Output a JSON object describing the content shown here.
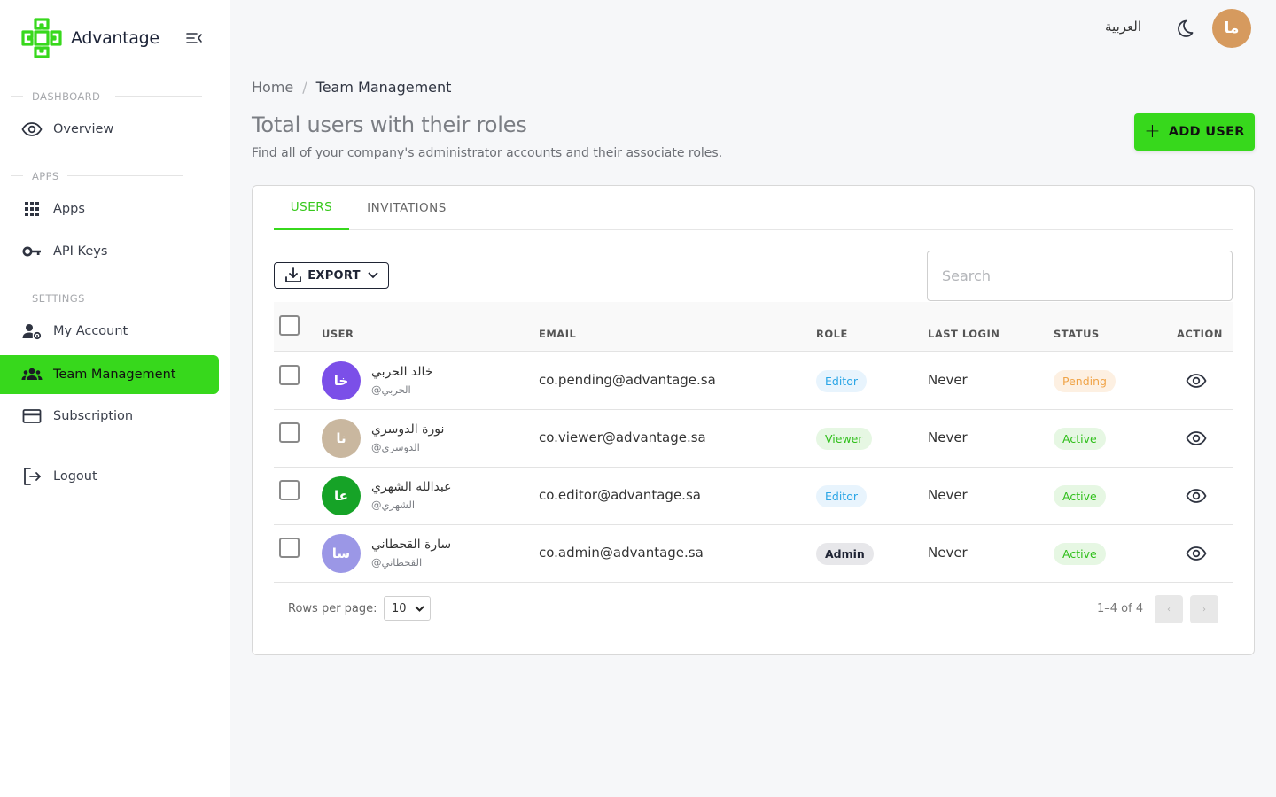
{
  "app": {
    "brand_name": "Advantage",
    "brand_color": "#37d81c"
  },
  "topbar": {
    "language_link": "العربية",
    "avatar_initials": "ما",
    "avatar_color": "#d69a5e"
  },
  "sidebar": {
    "sections": [
      {
        "label": "DASHBOARD",
        "items": [
          {
            "label": "Overview",
            "icon": "eye-icon"
          }
        ]
      },
      {
        "label": "APPS",
        "items": [
          {
            "label": "Apps",
            "icon": "apps-grid-icon"
          },
          {
            "label": "API Keys",
            "icon": "key-icon"
          }
        ]
      },
      {
        "label": "SETTINGS",
        "items": [
          {
            "label": "My Account",
            "icon": "user-settings-icon"
          },
          {
            "label": "Team Management",
            "icon": "team-icon",
            "active": true
          },
          {
            "label": "Subscription",
            "icon": "credit-card-icon"
          }
        ]
      }
    ],
    "logout_label": "Logout"
  },
  "breadcrumb": {
    "home": "Home",
    "separator": "/",
    "current": "Team Management"
  },
  "header": {
    "title": "Total users with their roles",
    "subtitle": "Find all of your company's administrator accounts and their associate roles.",
    "add_user_label": "ADD USER"
  },
  "tabs": [
    {
      "label": "USERS",
      "active": true
    },
    {
      "label": "INVITATIONS",
      "active": false
    }
  ],
  "toolbar": {
    "export_label": "EXPORT",
    "search_placeholder": "Search"
  },
  "table": {
    "columns": [
      "USER",
      "EMAIL",
      "ROLE",
      "LAST LOGIN",
      "STATUS",
      "ACTION"
    ],
    "rows": [
      {
        "initials": "خا",
        "avatar_color": "#7b4fe8",
        "name": "خالد الحربي",
        "handle": "@الحربي",
        "email": "co.pending@advantage.sa",
        "role": "Editor",
        "role_style": "editor",
        "last_login": "Never",
        "status": "Pending",
        "status_style": "pending"
      },
      {
        "initials": "نا",
        "avatar_color": "#c9b79f",
        "name": "نورة الدوسري",
        "handle": "@الدوسري",
        "email": "co.viewer@advantage.sa",
        "role": "Viewer",
        "role_style": "viewer",
        "last_login": "Never",
        "status": "Active",
        "status_style": "active"
      },
      {
        "initials": "عا",
        "avatar_color": "#16a327",
        "name": "عبدالله الشهري",
        "handle": "@الشهري",
        "email": "co.editor@advantage.sa",
        "role": "Editor",
        "role_style": "editor",
        "last_login": "Never",
        "status": "Active",
        "status_style": "active"
      },
      {
        "initials": "سا",
        "avatar_color": "#9b97e6",
        "name": "سارة القحطاني",
        "handle": "@القحطاني",
        "email": "co.admin@advantage.sa",
        "role": "Admin",
        "role_style": "admin",
        "last_login": "Never",
        "status": "Active",
        "status_style": "active"
      }
    ]
  },
  "pagination": {
    "rows_per_page_label": "Rows per page:",
    "rows_per_page_value": "10",
    "range_text": "1–4 of 4",
    "prev_symbol": "‹",
    "next_symbol": "›"
  }
}
